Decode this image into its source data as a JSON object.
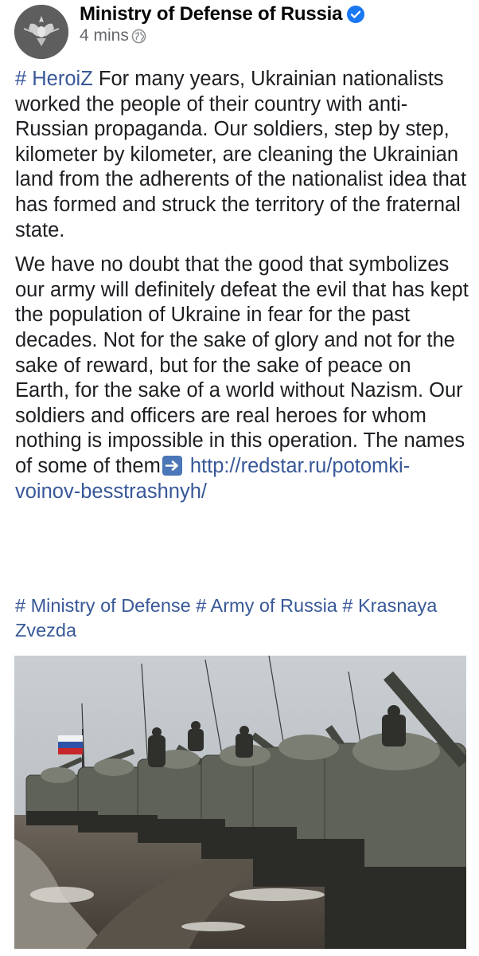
{
  "post": {
    "page_name": "Ministry of Defense of Russia",
    "timestamp": "4 mins",
    "verified_icon": "verified-badge-icon",
    "privacy_icon": "globe-icon",
    "paragraph1": {
      "hashtag": "# HeroiZ",
      "text": " For many years, Ukrainian nationalists worked the people of their country with anti-Russian propaganda. Our soldiers, step by step, kilometer by kilometer, are cleaning the Ukrainian land from the adherents of the nationalist idea that has formed and struck the territory of the fraternal state."
    },
    "paragraph2": {
      "text": "We have no doubt that the good that symbolizes our army will definitely defeat the evil that has kept the population of Ukraine in fear for the past decades. Not for the sake of glory and not for the sake of reward, but for the sake of peace on Earth, for the sake of a world without Nazism. Our soldiers and officers are real heroes for whom nothing is impossible in this operation. The names of some of them",
      "arrow_icon": "right-arrow-emoji-icon",
      "link": "http://redstar.ru/potomki-voinov-besstrashnyh/"
    },
    "tags": "# Ministry of Defense # Army of Russia # Krasnaya Zvezda",
    "image_icon": "photo-tanks-column"
  },
  "colors": {
    "link": "#385898",
    "text": "#1c1e21",
    "meta": "#65676b",
    "verified": "#1877f2"
  }
}
